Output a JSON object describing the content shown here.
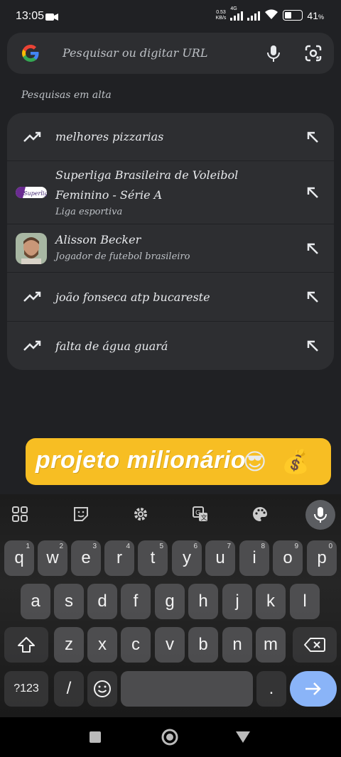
{
  "status": {
    "time": "13:05",
    "net_speed_top": "0.53",
    "net_speed_bottom": "KB/s",
    "network": "4G",
    "battery": "41"
  },
  "search": {
    "placeholder": "Pesquisar ou digitar URL"
  },
  "trending": {
    "title": "Pesquisas em alta",
    "items": [
      {
        "title": "melhores pizzarias",
        "subtitle": "",
        "icon": "trending-up-icon"
      },
      {
        "title": "Superliga Brasileira de Voleibol Feminino - Série A",
        "subtitle": "Liga esportiva",
        "icon": "superliga-logo"
      },
      {
        "title": "Alisson Becker",
        "subtitle": "Jogador de futebol brasileiro",
        "icon": "alisson-photo"
      },
      {
        "title": "joão fonseca atp bucareste",
        "subtitle": "",
        "icon": "trending-up-icon"
      },
      {
        "title": "falta de água guará",
        "subtitle": "",
        "icon": "trending-up-icon"
      }
    ]
  },
  "banner": {
    "text": "projeto milionário",
    "emoji_1": "😎",
    "emoji_2": "💰",
    "color": "#f7be23"
  },
  "keyboard": {
    "row1": [
      {
        "k": "q",
        "h": "1"
      },
      {
        "k": "w",
        "h": "2"
      },
      {
        "k": "e",
        "h": "3"
      },
      {
        "k": "r",
        "h": "4"
      },
      {
        "k": "t",
        "h": "5"
      },
      {
        "k": "y",
        "h": "6"
      },
      {
        "k": "u",
        "h": "7"
      },
      {
        "k": "i",
        "h": "8"
      },
      {
        "k": "o",
        "h": "9"
      },
      {
        "k": "p",
        "h": "0"
      }
    ],
    "row2": [
      "a",
      "s",
      "d",
      "f",
      "g",
      "h",
      "j",
      "k",
      "l"
    ],
    "row3": [
      "z",
      "x",
      "c",
      "v",
      "b",
      "n",
      "m"
    ],
    "symbols_label": "?123",
    "slash_label": "/",
    "period_label": ".",
    "accent_color": "#8ab4f8"
  }
}
